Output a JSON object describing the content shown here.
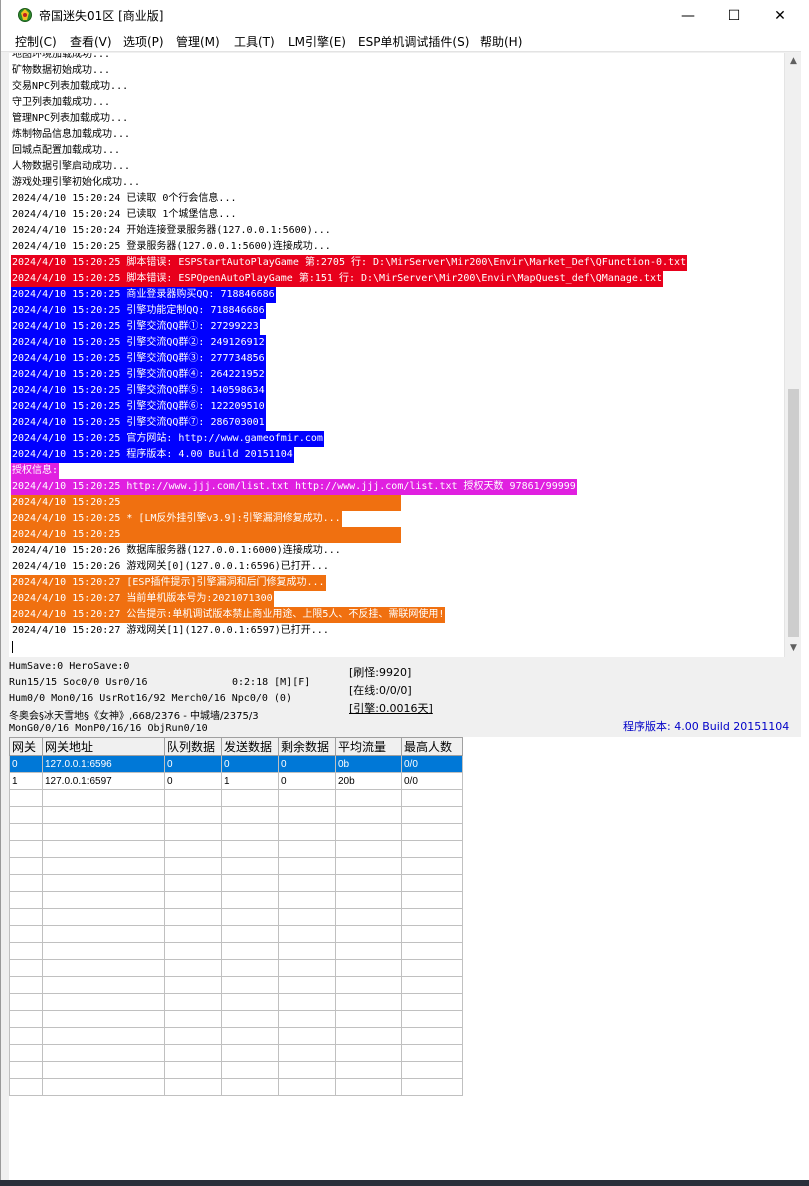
{
  "window": {
    "title": "帝国迷失01区 [商业版]",
    "controls": {
      "minimize": "—",
      "maximize": "☐",
      "close": "✕"
    }
  },
  "menu": [
    "控制(C)",
    "查看(V)",
    "选项(P)",
    "管理(M)",
    "工具(T)",
    "LM引擎(E)",
    "ESP单机调试插件(S)",
    "帮助(H)"
  ],
  "colors": {
    "red": "#e8001c",
    "blue": "#0000ff",
    "magenta": "#e020e0",
    "orange": "#f07010",
    "selection": "#0078d7",
    "version_text": "#0000c8"
  },
  "log": [
    {
      "text": "地图环境加载成功...",
      "style": "plain"
    },
    {
      "text": "矿物数据初始成功...",
      "style": "plain"
    },
    {
      "text": "交易NPC列表加载成功...",
      "style": "plain"
    },
    {
      "text": "守卫列表加载成功...",
      "style": "plain"
    },
    {
      "text": "管理NPC列表加载成功...",
      "style": "plain"
    },
    {
      "text": "炼制物品信息加载成功...",
      "style": "plain"
    },
    {
      "text": "回城点配置加载成功...",
      "style": "plain"
    },
    {
      "text": "人物数据引擎启动成功...",
      "style": "plain"
    },
    {
      "text": "游戏处理引擎初始化成功...",
      "style": "plain"
    },
    {
      "text": "2024/4/10 15:20:24 已读取 0个行会信息...",
      "style": "plain"
    },
    {
      "text": "2024/4/10 15:20:24 已读取 1个城堡信息...",
      "style": "plain"
    },
    {
      "text": "2024/4/10 15:20:24 开始连接登录服务器(127.0.0.1:5600)...",
      "style": "plain"
    },
    {
      "text": "2024/4/10 15:20:25 登录服务器(127.0.0.1:5600)连接成功...",
      "style": "plain"
    },
    {
      "text": "2024/4/10 15:20:25 脚本错误: ESPStartAutoPlayGame 第:2705 行: D:\\MirServer\\Mir200\\Envir\\Market_Def\\QFunction-0.txt",
      "style": "red"
    },
    {
      "text": "2024/4/10 15:20:25 脚本错误: ESPOpenAutoPlayGame 第:151 行: D:\\MirServer\\Mir200\\Envir\\MapQuest_def\\QManage.txt",
      "style": "red"
    },
    {
      "text": "2024/4/10 15:20:25 商业登录器购买QQ: 718846686",
      "style": "blue"
    },
    {
      "text": "2024/4/10 15:20:25 引擎功能定制QQ: 718846686",
      "style": "blue"
    },
    {
      "text": "2024/4/10 15:20:25 引擎交流QQ群①: 27299223",
      "style": "blue"
    },
    {
      "text": "2024/4/10 15:20:25 引擎交流QQ群②: 249126912",
      "style": "blue"
    },
    {
      "text": "2024/4/10 15:20:25 引擎交流QQ群③: 277734856",
      "style": "blue"
    },
    {
      "text": "2024/4/10 15:20:25 引擎交流QQ群④: 264221952",
      "style": "blue"
    },
    {
      "text": "2024/4/10 15:20:25 引擎交流QQ群⑤: 140598634",
      "style": "blue"
    },
    {
      "text": "2024/4/10 15:20:25 引擎交流QQ群⑥: 122209510",
      "style": "blue"
    },
    {
      "text": "2024/4/10 15:20:25 引擎交流QQ群⑦: 286703001",
      "style": "blue"
    },
    {
      "text": "2024/4/10 15:20:25 官方网站: http://www.gameofmir.com",
      "style": "blue"
    },
    {
      "text": "2024/4/10 15:20:25 程序版本: 4.00 Build 20151104",
      "style": "blue"
    },
    {
      "text": "授权信息:",
      "style": "magenta"
    },
    {
      "text": "2024/4/10 15:20:25 http://www.jjj.com/list.txt http://www.jjj.com/list.txt 授权天数 97861/99999",
      "style": "magenta"
    },
    {
      "text": "2024/4/10 15:20:25",
      "style": "orange-bar"
    },
    {
      "text": "2024/4/10 15:20:25 * [LM反外挂引擎v3.9]:引擎漏洞修复成功...",
      "style": "orange"
    },
    {
      "text": "2024/4/10 15:20:25",
      "style": "orange-bar"
    },
    {
      "text": "2024/4/10 15:20:26 数据库服务器(127.0.0.1:6000)连接成功...",
      "style": "plain"
    },
    {
      "text": "2024/4/10 15:20:26 游戏网关[0](127.0.0.1:6596)已打开...",
      "style": "plain"
    },
    {
      "text": "2024/4/10 15:20:27 [ESP插件提示]引擎漏洞和后门修复成功...",
      "style": "orange"
    },
    {
      "text": "2024/4/10 15:20:27 当前单机版本号为:2021071300",
      "style": "orange"
    },
    {
      "text": "2024/4/10 15:20:27 公告提示:单机调试版本禁止商业用途、上限5人、不反挂、需联网使用!",
      "style": "orange"
    },
    {
      "text": "2024/4/10 15:20:27 游戏网关[1](127.0.0.1:6597)已打开...",
      "style": "plain"
    }
  ],
  "status": {
    "line1": "HumSave:0 HeroSave:0",
    "line2": "Run15/15 Soc0/0 Usr0/16",
    "timer": "0:2:18 [M][F]",
    "line3": "Hum0/0 Mon0/16 UsrRot16/92 Merch0/16 Npc0/0 (0)",
    "line4": "冬奥会§冰天雪地§《女神》,668/2376 - 中城墙/2375/3",
    "line5": "MonG0/0/16 MonP0/16/16 ObjRun0/10",
    "refresh": "[刷怪:9920]",
    "online": "[在线:0/0/0]",
    "engine": "[引擎:0.0016天]",
    "version": "程序版本: 4.00 Build 20151104"
  },
  "table": {
    "headers": [
      "网关",
      "网关地址",
      "队列数据",
      "发送数据",
      "剩余数据",
      "平均流量",
      "最高人数"
    ],
    "rows": [
      [
        "0",
        "127.0.0.1:6596",
        "0",
        "0",
        "0",
        "0b",
        "0/0"
      ],
      [
        "1",
        "127.0.0.1:6597",
        "0",
        "1",
        "0",
        "20b",
        "0/0"
      ]
    ],
    "empty_rows": 18
  }
}
